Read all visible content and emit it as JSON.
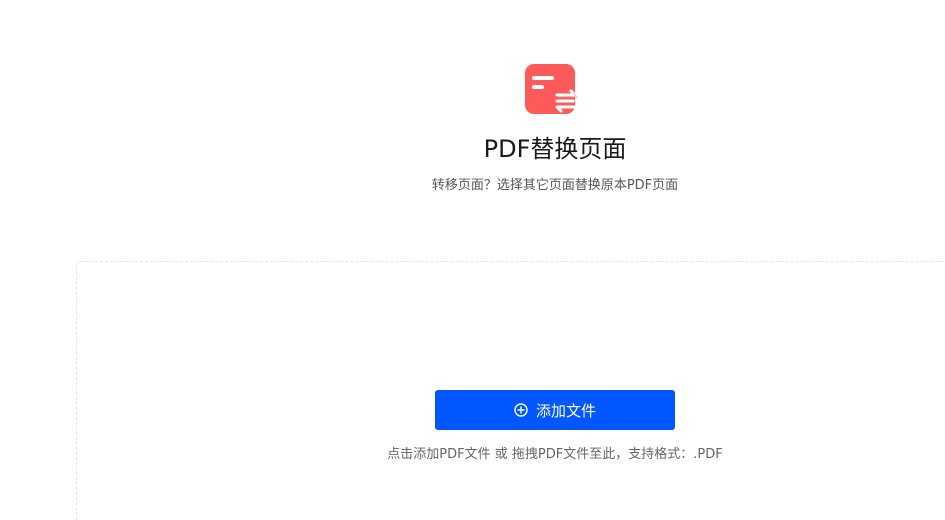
{
  "header": {
    "icon": "replace-pages-icon",
    "title": "PDF替换页面",
    "subtitle": "转移页面？选择其它页面替换原本PDF页面"
  },
  "upload": {
    "button_icon": "plus-circle-icon",
    "button_label": "添加文件",
    "hint": "点击添加PDF文件 或 拖拽PDF文件至此，支持格式：.PDF"
  },
  "colors": {
    "icon_bg": "#ff5a5a",
    "button_bg": "#0057ff"
  }
}
